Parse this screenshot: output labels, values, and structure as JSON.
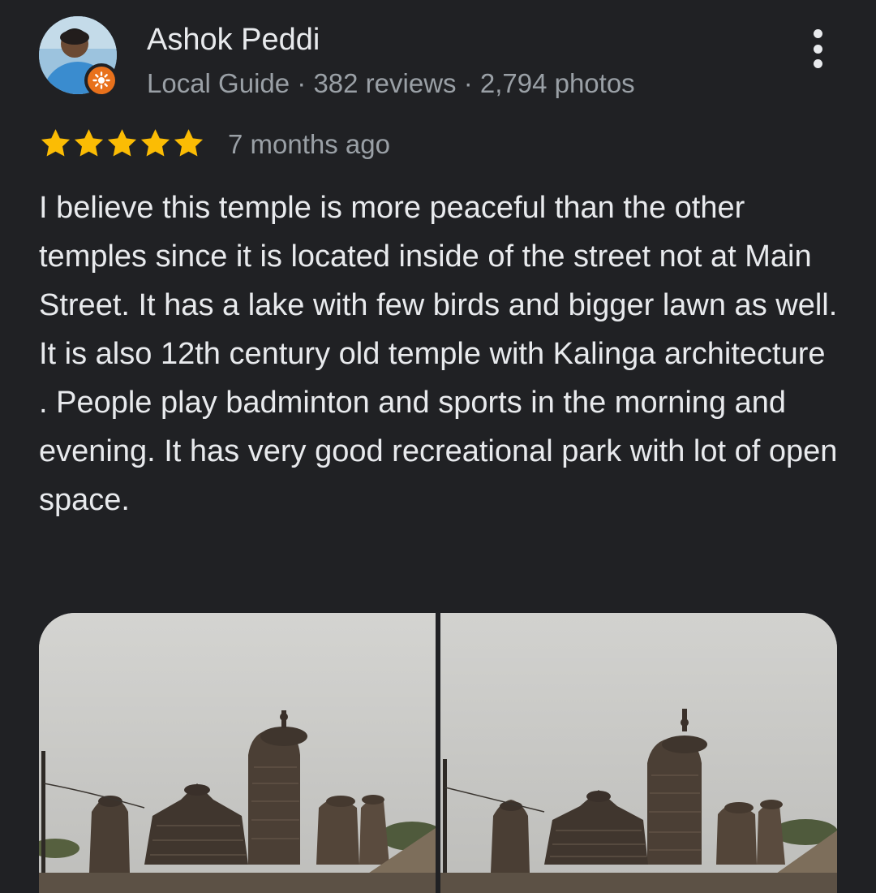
{
  "reviewer": {
    "name": "Ashok Peddi",
    "meta": "Local Guide · 382 reviews · 2,794 photos",
    "avatar_icon": "user-avatar",
    "badge_icon": "local-guide-badge-icon",
    "badge_color": "#e8711c"
  },
  "menu": {
    "icon": "more-vert-icon"
  },
  "rating": {
    "stars": 5,
    "max": 5,
    "time": "7 months ago",
    "star_color": "#fbbc04"
  },
  "review": {
    "text": "I believe this temple is more peaceful than the other temples since it is located inside of the street not at Main Street. It has a lake with few birds and bigger lawn as well. It is also 12th century old temple with Kalinga architecture . People play badminton and sports in the morning and evening. It has very good recreational park with lot of open space."
  },
  "photos": [
    {
      "subject": "temple-photo"
    },
    {
      "subject": "temple-photo"
    }
  ],
  "theme": {
    "background": "#202124",
    "text_primary": "#e8eaed",
    "text_secondary": "#9aa0a6"
  }
}
